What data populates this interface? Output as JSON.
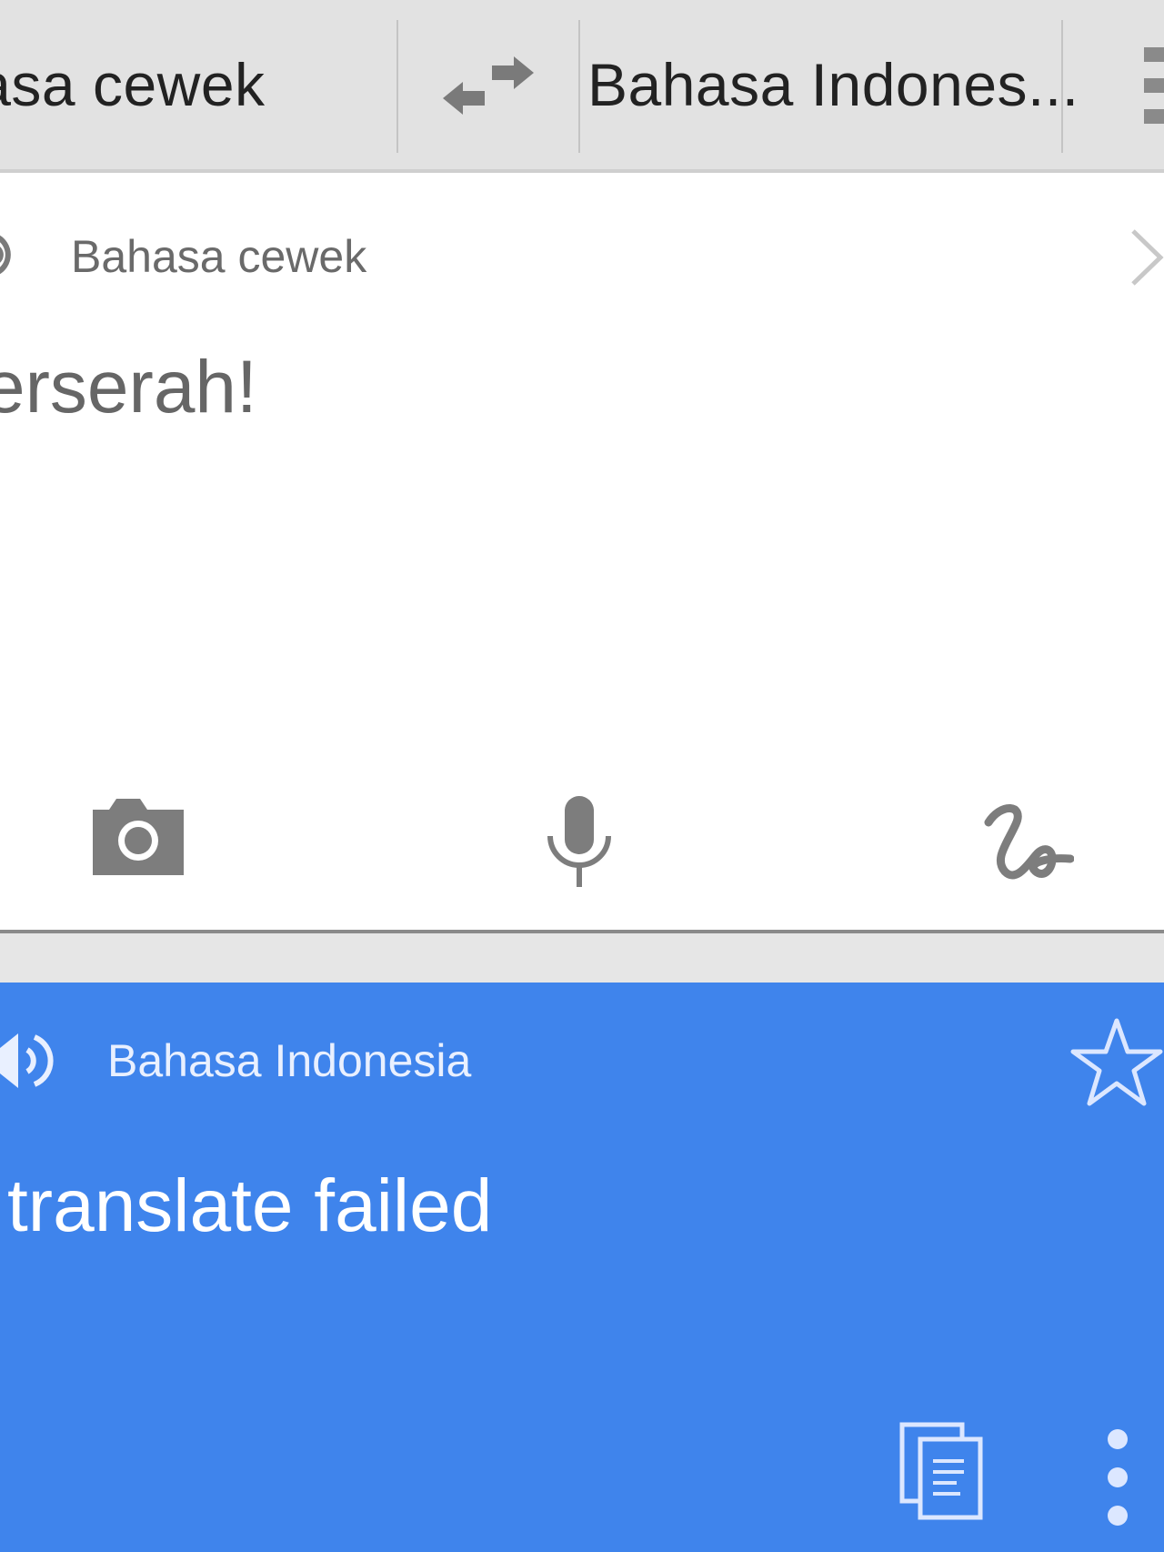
{
  "language_bar": {
    "source_language": "hasa cewek",
    "target_language": "Bahasa Indones...",
    "swap_icon": "swap-arrows-icon",
    "menu_icon": "menu-icon"
  },
  "source_panel": {
    "language_label": "Bahasa cewek",
    "input_text": "erserah!",
    "speaker_icon": "speaker-icon",
    "clear_icon": "chevron-right-icon",
    "tools": [
      "camera-icon",
      "microphone-icon",
      "handwriting-icon"
    ]
  },
  "result_panel": {
    "language_label": "Bahasa Indonesia",
    "translation": "translate failed",
    "star_icon": "star-outline-icon",
    "copy_icon": "copy-icon",
    "more_icon": "more-vert-icon"
  },
  "colors": {
    "bar_background": "#e2e2e2",
    "result_background": "#3f84ec",
    "icon_gray": "#777777"
  }
}
